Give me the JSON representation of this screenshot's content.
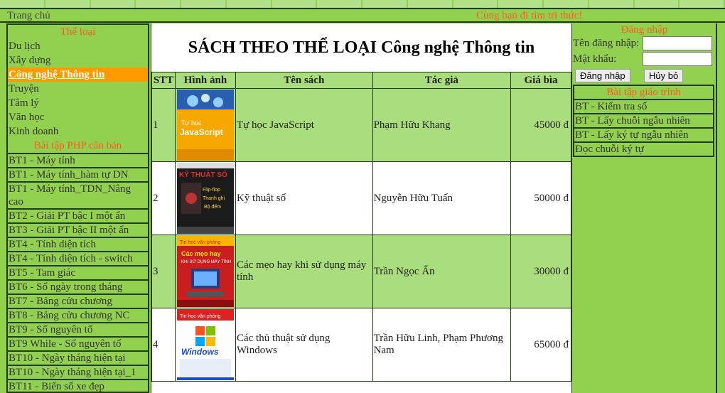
{
  "header": {
    "home_link": "Trang chủ",
    "slogan": "Cùng bạn đi tìm tri thức!"
  },
  "left_sidebar": {
    "categories_title": "Thể loại",
    "categories": [
      "Du lịch",
      "Xây dựng",
      "Công nghệ Thông tin",
      "Truyện",
      "Tâm lý",
      "Văn học",
      "Kinh doanh"
    ],
    "active_category": "Công nghệ Thông tin",
    "exercises_title": "Bài tập PHP căn bản",
    "exercises": [
      "BT1 - Máy tính",
      "BT1 - Máy tính_hàm tự DN",
      "BT1 - Máy tính_TDN_Nâng cao",
      "BT2 - Giải PT bậc I một ẩn",
      "BT3 - Giải PT bậc II một ẩn",
      "BT4 - Tính diện tích",
      "BT4 - Tính diện tích - switch",
      "BT5 - Tam giác",
      "BT6 - Số ngày trong tháng",
      "BT7 - Bảng cửu chương",
      "BT8 - Bảng cửu chương NC",
      "BT9 - Số nguyên tố",
      "BT9 While - Số nguyên tố",
      "BT10 - Ngày tháng hiện tại",
      "BT10 - Ngày tháng hiện tại_1",
      "BT11 - Biến số xe đẹp"
    ]
  },
  "main": {
    "title": "SÁCH THEO THỂ LOẠI Công nghệ Thông tin",
    "columns": [
      "STT",
      "Hình ảnh",
      "Tên sách",
      "Tác giả",
      "Giá bìa"
    ],
    "books": [
      {
        "stt": "1",
        "name": "Tự học JavaScript",
        "author": "Phạm Hữu Khang",
        "price": "45000 đ",
        "cover": {
          "top": "Tự học",
          "main": "JavaScript"
        }
      },
      {
        "stt": "2",
        "name": "Kỹ thuật số",
        "author": "Nguyễn Hữu Tuấn",
        "price": "50000 đ",
        "cover": {
          "top": "KỸ THUẬT SỐ",
          "main": "Flip-flop Thanh ghi Bộ đếm"
        }
      },
      {
        "stt": "3",
        "name": "Các mẹo hay khi sử dụng máy tính",
        "author": "Trần Ngọc Ẩn",
        "price": "30000 đ",
        "cover": {
          "top": "Tin học văn phòng",
          "main": "Các mẹo hay KHI SỬ DỤNG MÁY TÍNH"
        }
      },
      {
        "stt": "4",
        "name": "Các thủ thuật sử dụng Windows",
        "author": "Trần Hữu Linh, Phạm Phương Nam",
        "price": "65000 đ",
        "cover": {
          "top": "Tin học văn phòng",
          "main": "Windows"
        }
      }
    ]
  },
  "right_sidebar": {
    "login_title": "Đăng nhập",
    "username_label": "Tên đăng nhập:",
    "username_value": "",
    "password_label": "Mật khẩu:",
    "password_value": "",
    "login_button": "Đăng nhập",
    "cancel_button": "Hủy bỏ",
    "tutorial_title": "Bài tập giáo trình",
    "tutorials": [
      "BT - Kiểm tra số",
      "BT - Lấy chuỗi ngẫu nhiên",
      "BT - Lấy ký tự ngẫu nhiên",
      "Đọc chuỗi ký tự"
    ]
  },
  "colors": {
    "page_bg": "#92d050",
    "accent_orange": "#ff5a1e",
    "active_bg": "#ff9900",
    "row_alt": "#a9dd7d",
    "border": "#1f3d0c"
  }
}
